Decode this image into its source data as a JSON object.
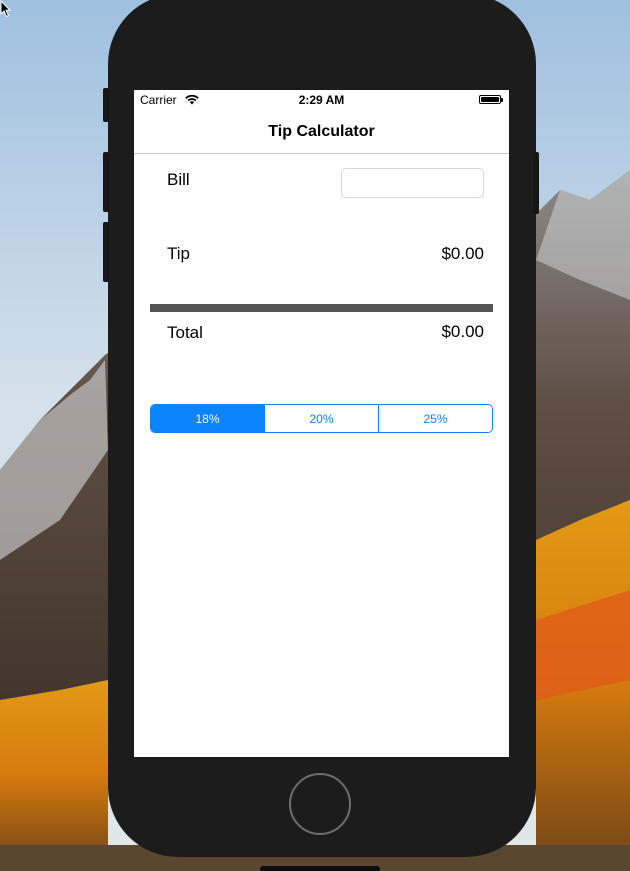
{
  "status_bar": {
    "carrier": "Carrier",
    "time": "2:29 AM"
  },
  "nav": {
    "title": "Tip Calculator"
  },
  "bill": {
    "label": "Bill",
    "value": "",
    "placeholder": ""
  },
  "tip": {
    "label": "Tip",
    "value": "$0.00"
  },
  "total": {
    "label": "Total",
    "value": "$0.00"
  },
  "tip_segments": {
    "options": [
      "18%",
      "20%",
      "25%"
    ],
    "selected": "18%"
  },
  "colors": {
    "accent": "#0a84ff",
    "divider": "#555555",
    "phone_body": "#1c1c1c"
  }
}
